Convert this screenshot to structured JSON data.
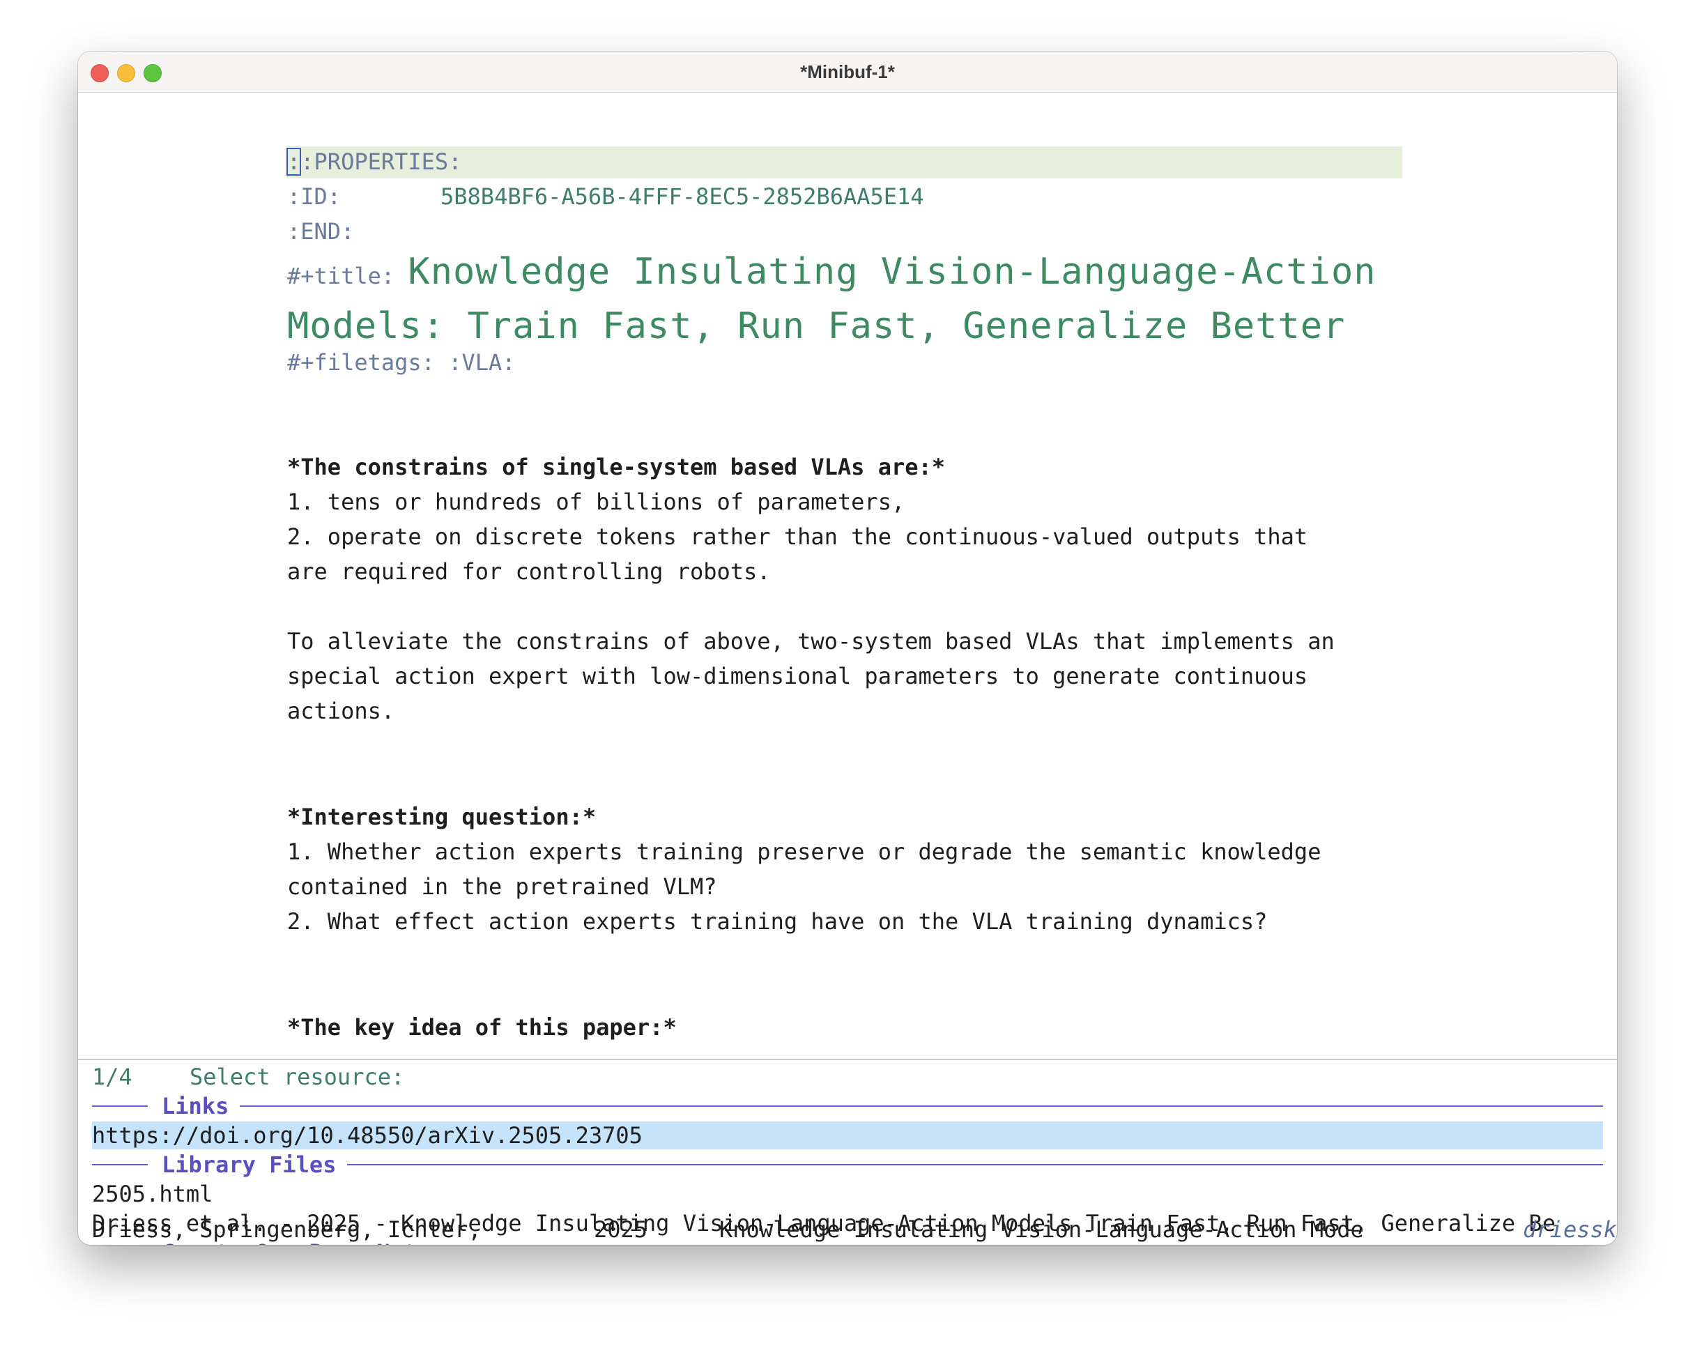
{
  "window": {
    "title": "*Minibuf-1*"
  },
  "buffer": {
    "properties_open": ":PROPERTIES:",
    "id_key": ":ID:",
    "id_value": "5B8B4BF6-A56B-4FFF-8EC5-2852B6AA5E14",
    "end": ":END:",
    "title_key": "#+title:",
    "title_line1": "Knowledge Insulating Vision-Language-Action",
    "title_line2": "Models: Train Fast, Run Fast, Generalize Better",
    "filetags": "#+filetags: :VLA:",
    "section1_heading": "*The constrains of single-system based VLAs are:*",
    "section1_item1": "1. tens or hundreds of billions of parameters,",
    "section1_item2a": "2. operate on discrete tokens rather than the continuous-valued outputs that",
    "section1_item2b": "are required for controlling robots.",
    "para1_line1": "To alleviate the constrains of above, two-system based VLAs that implements an",
    "para1_line2": "special action expert with low-dimensional parameters to generate continuous",
    "para1_line3": "actions.",
    "section2_heading": "*Interesting question:*",
    "section2_item1a": "1. Whether action experts training preserve or degrade the semantic knowledge",
    "section2_item1b": "contained in the pretrained VLM?",
    "section2_item2": "2. What effect action experts training have on the VLA training dynamics?",
    "section3_heading": "*The key idea of this paper:*"
  },
  "minibuffer": {
    "count": "1/4",
    "prompt": "Select resource:",
    "groups": {
      "links": "Links",
      "library_files": "Library Files",
      "create_notes": "Create Org-Roam Notes"
    },
    "link_url": "https://doi.org/10.48550/arXiv.2505.23705",
    "file1": "2505.html",
    "file2": "Driess et al. - 2025 - Knowledge Insulating Vision-Language-Action Models Train Fast, Run Fast, Generalize Be",
    "note_authors": "Driess, Springenberg, Ichter,",
    "note_year": "2025",
    "note_title": "Knowledge Insulating Vision-Language-Action Mode",
    "note_key": "driessk"
  }
}
